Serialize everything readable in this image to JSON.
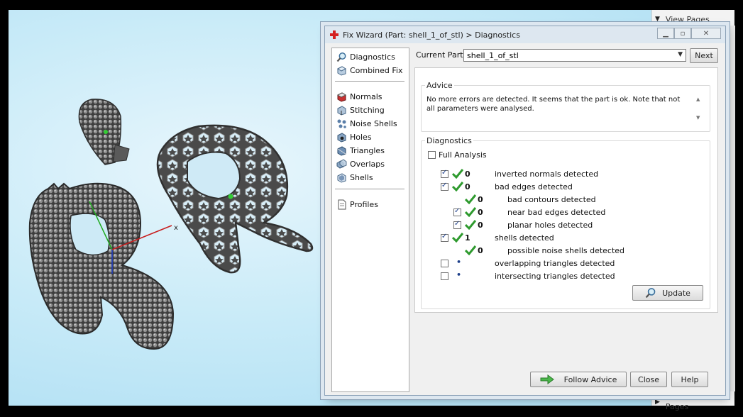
{
  "right_panel": {
    "view_pages": "View Pages",
    "measurement_pages": "Measurement Pages"
  },
  "viewport": {
    "axis_x_label": "x"
  },
  "dialog": {
    "title": "Fix Wizard (Part: shell_1_of_stl) > Diagnostics",
    "nav": {
      "group1": [
        "Diagnostics",
        "Combined Fix"
      ],
      "group2": [
        "Normals",
        "Stitching",
        "Noise Shells",
        "Holes",
        "Triangles",
        "Overlaps",
        "Shells"
      ],
      "group3": [
        "Profiles"
      ]
    },
    "current_part_label": "Current Part:",
    "current_part_value": "shell_1_of_stl",
    "next_button": "Next",
    "advice": {
      "title": "Advice",
      "text": "No more errors are detected. It seems that the part is ok. Note that not all parameters were analysed."
    },
    "diagnostics": {
      "title": "Diagnostics",
      "full_analysis_label": "Full Analysis",
      "rows": [
        {
          "text": "inverted normals detected",
          "count": "0"
        },
        {
          "text": "bad edges detected",
          "count": "0"
        },
        {
          "text": "bad contours detected",
          "count": "0"
        },
        {
          "text": "near bad edges detected",
          "count": "0"
        },
        {
          "text": "planar holes detected",
          "count": "0"
        },
        {
          "text": "shells detected",
          "count": "1"
        },
        {
          "text": "possible noise shells detected",
          "count": "0"
        },
        {
          "text": "overlapping triangles detected",
          "count": ""
        },
        {
          "text": "intersecting triangles detected",
          "count": ""
        }
      ],
      "update_button": "Update"
    },
    "buttons": {
      "follow_advice": "Follow Advice",
      "close": "Close",
      "help": "Help"
    }
  },
  "colors": {
    "check_green": "#2e9a2e",
    "title_bar": "#dde7f0",
    "accent_blue": "#1d3f8a"
  }
}
